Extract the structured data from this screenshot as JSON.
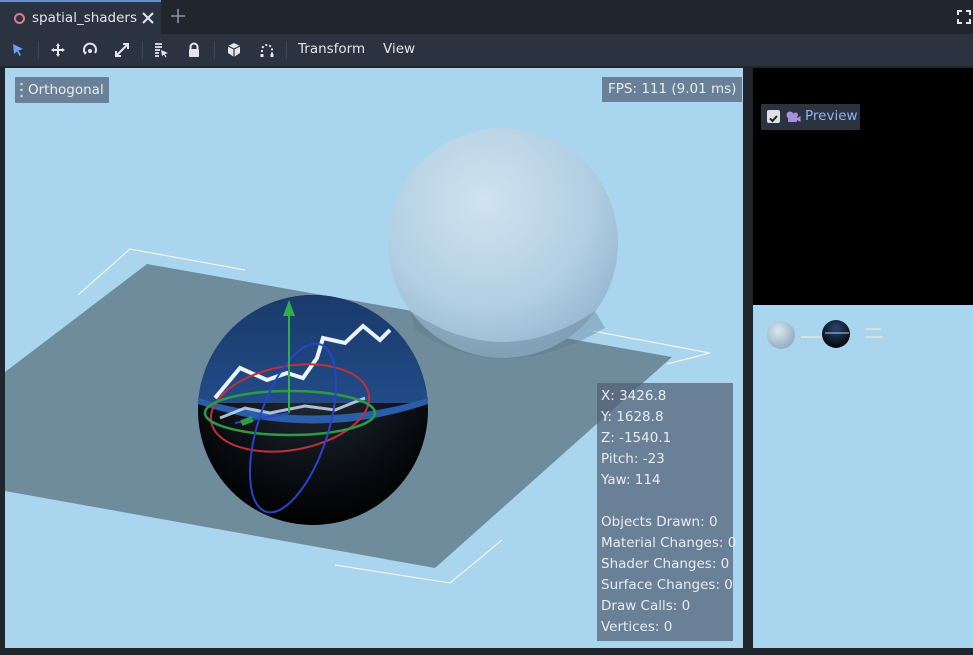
{
  "tabs": [
    {
      "title": "spatial_shaders"
    }
  ],
  "toolbar": {
    "tools": [
      "select-tool",
      "move-tool",
      "rotate-tool",
      "scale-tool",
      "list-select-tool",
      "lock-tool",
      "group-tool",
      "snap-tool"
    ],
    "menus": {
      "transform": "Transform",
      "view": "View"
    }
  },
  "viewport": {
    "projection_label": "Orthogonal",
    "fps_label": "FPS: 111 (9.01 ms)",
    "stats": {
      "x": "X: 3426.8",
      "y": "Y: 1628.8",
      "z": "Z: -1540.1",
      "pitch": "Pitch: -23",
      "yaw": "Yaw: 114",
      "objects_drawn": "Objects Drawn: 0",
      "material_changes": "Material Changes: 0",
      "shader_changes": "Shader Changes: 0",
      "surface_changes": "Surface Changes: 0",
      "draw_calls": "Draw Calls: 0",
      "vertices": "Vertices: 0"
    },
    "background_color": "#a9d5ef"
  },
  "preview_panel": {
    "checkbox_checked": true,
    "label": "Preview"
  },
  "colors": {
    "editor_bg": "#20252e",
    "toolbar_bg": "#2c3340",
    "accent": "#6b8ecf",
    "preview_label": "#8fb4f0"
  }
}
